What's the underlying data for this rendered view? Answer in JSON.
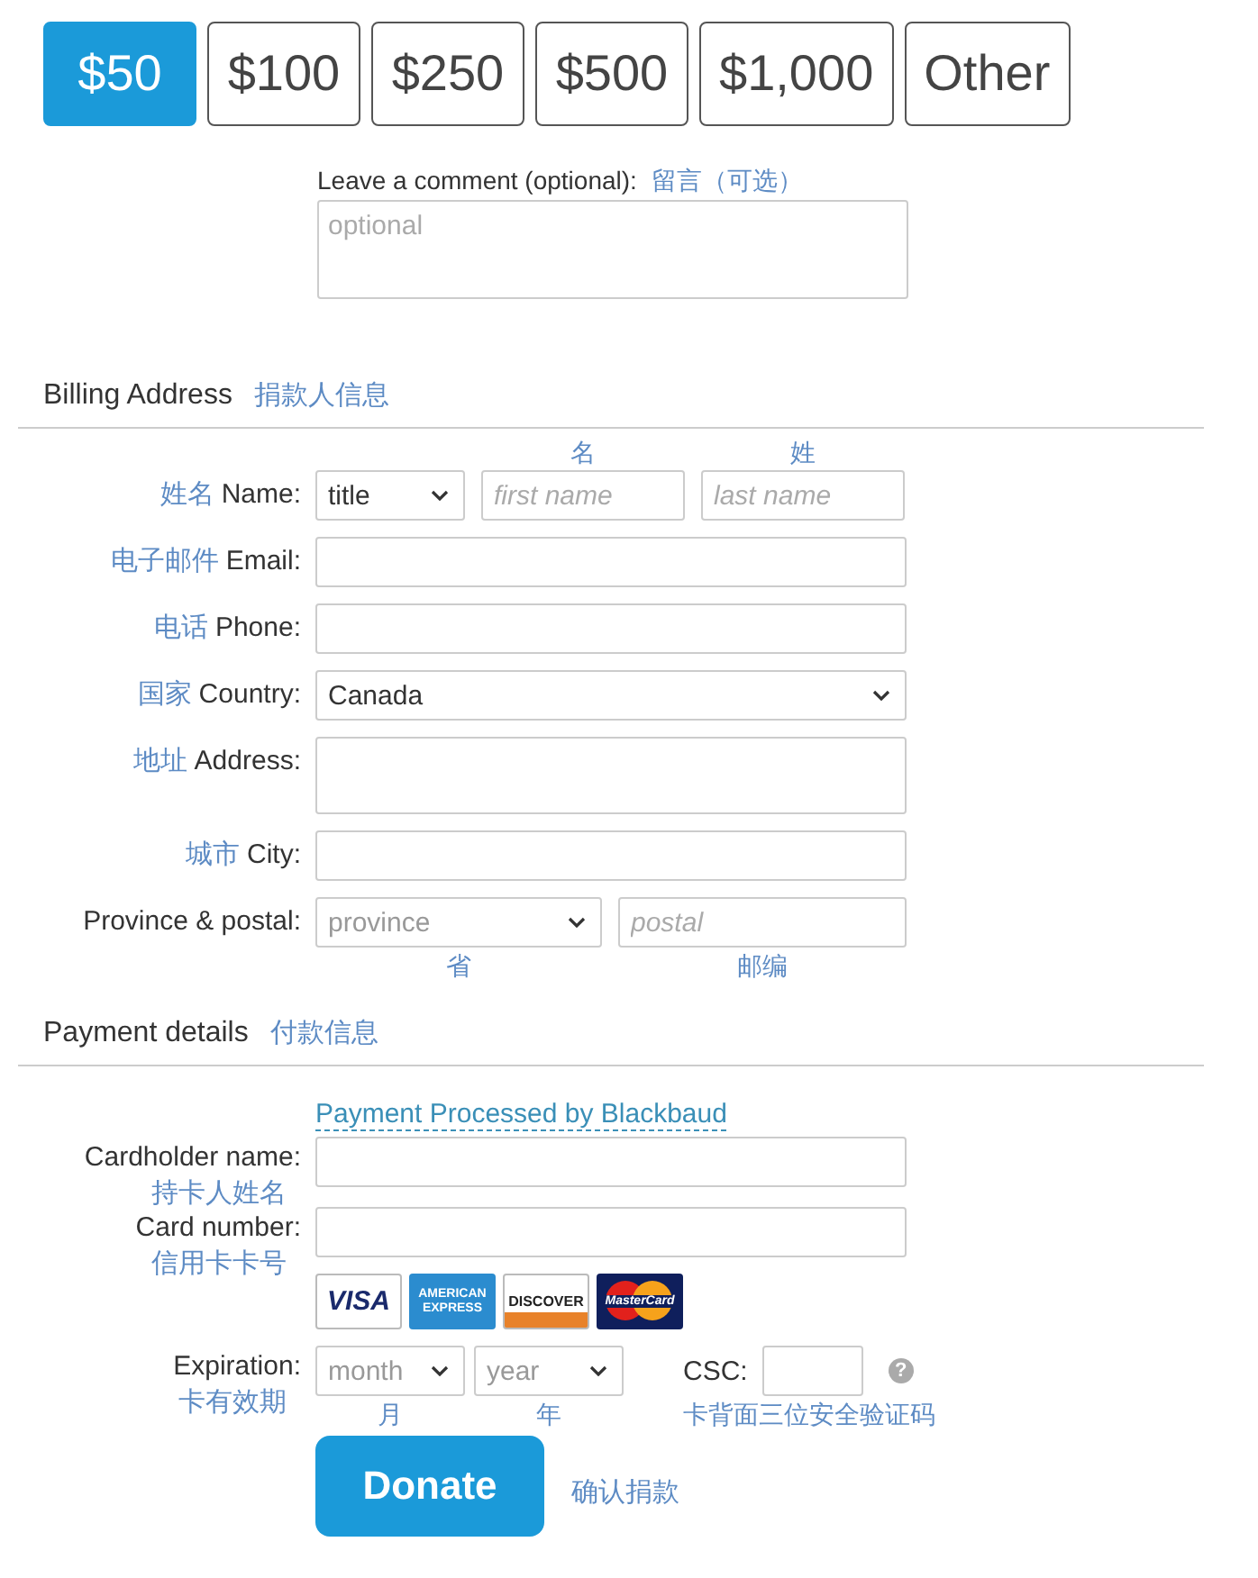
{
  "amounts": [
    {
      "label": "$50",
      "selected": true
    },
    {
      "label": "$100",
      "selected": false
    },
    {
      "label": "$250",
      "selected": false
    },
    {
      "label": "$500",
      "selected": false
    },
    {
      "label": "$1,000",
      "selected": false
    },
    {
      "label": "Other",
      "selected": false
    }
  ],
  "comment": {
    "label": "Leave a comment (optional):",
    "note": "留言（可选）",
    "placeholder": "optional"
  },
  "billing": {
    "title": "Billing Address",
    "note": "捐款人信息",
    "rows": [
      {
        "kind": "name",
        "note": "姓名",
        "label": "Name:",
        "controls": [
          {
            "kind": "select",
            "value": "title"
          },
          {
            "kind": "input",
            "placeholder": "first name",
            "caption_above": "名"
          },
          {
            "kind": "input",
            "placeholder": "last name",
            "caption_above": "姓"
          }
        ]
      },
      {
        "kind": "single",
        "note": "电子邮件",
        "label": "Email:",
        "controls": [
          {
            "kind": "input"
          }
        ]
      },
      {
        "kind": "single",
        "note": "电话",
        "label": "Phone:",
        "controls": [
          {
            "kind": "input"
          }
        ]
      },
      {
        "kind": "single",
        "note": "国家",
        "label": "Country:",
        "controls": [
          {
            "kind": "select",
            "value": "Canada"
          }
        ]
      },
      {
        "kind": "single",
        "note": "地址",
        "label": "Address:",
        "controls": [
          {
            "kind": "textarea"
          }
        ]
      },
      {
        "kind": "single",
        "note": "城市",
        "label": "City:",
        "controls": [
          {
            "kind": "input"
          }
        ]
      },
      {
        "kind": "pair",
        "label": "Province & postal:",
        "controls": [
          {
            "kind": "select",
            "placeholder": "province",
            "caption_below": "省"
          },
          {
            "kind": "input",
            "placeholder": "postal",
            "caption_below": "邮编"
          }
        ]
      }
    ]
  },
  "payment": {
    "title": "Payment details",
    "note": "付款信息",
    "link": "Payment Processed by Blackbaud",
    "rows": [
      {
        "kind": "single",
        "label": "Cardholder name:",
        "note_below": "持卡人姓名",
        "controls": [
          {
            "kind": "input"
          }
        ]
      },
      {
        "kind": "single",
        "label": "Card number:",
        "note_below": "信用卡卡号",
        "controls": [
          {
            "kind": "input"
          }
        ]
      },
      {
        "kind": "cards",
        "cards": [
          {
            "kind": "visa",
            "label": "VISA"
          },
          {
            "kind": "amex",
            "label": "AMERICAN EXPRESS"
          },
          {
            "kind": "discover",
            "label": "DISCOVER"
          },
          {
            "kind": "mastercard",
            "label": "MasterCard"
          }
        ]
      },
      {
        "kind": "expiry",
        "label": "Expiration:",
        "note_below": "卡有效期",
        "controls": [
          {
            "kind": "select",
            "placeholder": "month",
            "caption_below": "月"
          },
          {
            "kind": "select",
            "placeholder": "year",
            "caption_below": "年"
          },
          {
            "kind": "csc",
            "label": "CSC:",
            "help": "?",
            "caption_below": "卡背面三位安全验证码"
          }
        ]
      }
    ]
  },
  "donate": {
    "label": "Donate",
    "note": "确认捐款"
  }
}
